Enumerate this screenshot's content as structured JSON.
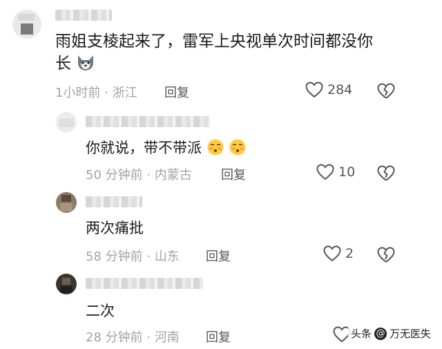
{
  "comments": [
    {
      "text_line1": "雨姐支棱起来了，雷军上央视单次时间都没你",
      "text_line2": "长",
      "time": "1小时前",
      "location": "浙江",
      "reply_label": "回复",
      "likes": "284",
      "emoji": "wolf-face"
    },
    {
      "text": "你就说，带不带派",
      "time": "50 分钟前",
      "location": "内蒙古",
      "reply_label": "回复",
      "likes": "10",
      "emoji": "flushed-face"
    },
    {
      "text": "两次痛批",
      "time": "58 分钟前",
      "location": "山东",
      "reply_label": "回复",
      "likes": "2"
    },
    {
      "text": "二次",
      "time": "28 分钟前",
      "location": "河南",
      "reply_label": "回复",
      "likes": ""
    }
  ],
  "separator": " · ",
  "watermark": {
    "prefix": "头条",
    "at": "@",
    "author": "万无医失"
  },
  "colors": {
    "text": "#1a1a1a",
    "meta": "#a3a3a3",
    "reply": "#555555"
  }
}
